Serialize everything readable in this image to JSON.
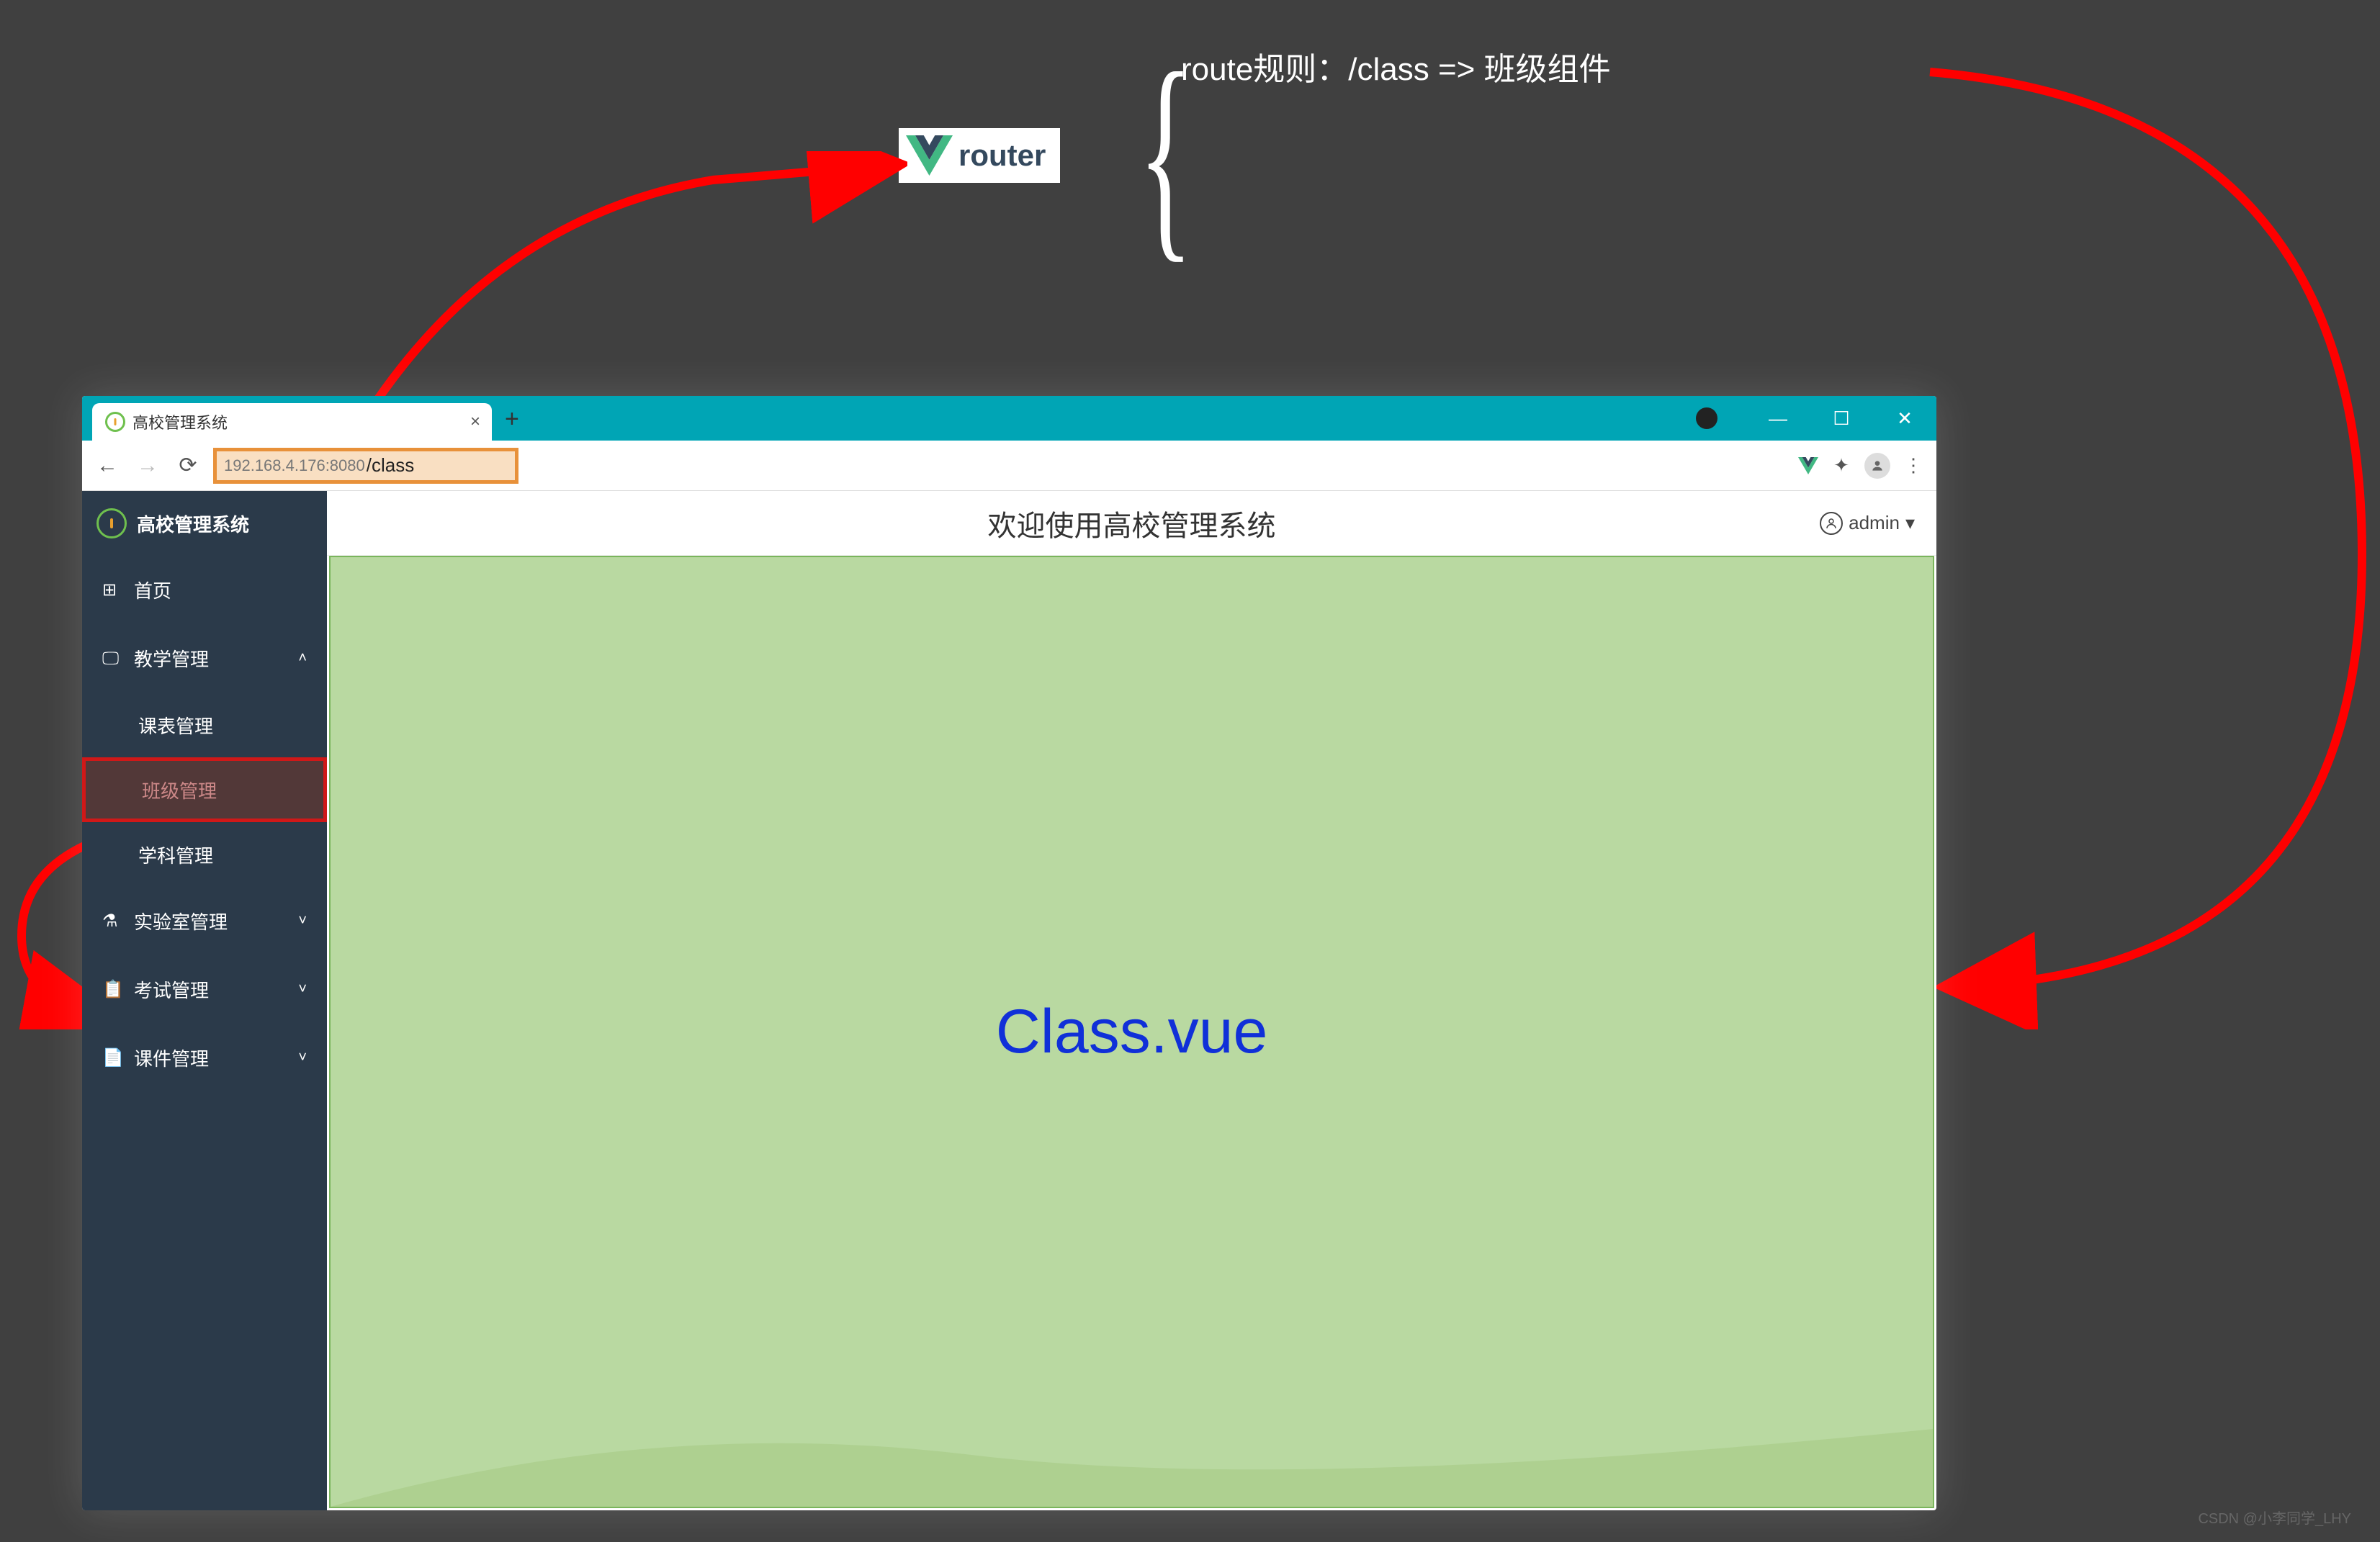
{
  "router": {
    "label": "router",
    "rule_text": "route规则：/class =>  班级组件"
  },
  "browser": {
    "tab_title": "高校管理系统",
    "url_ip": "192.168.4.176:8080",
    "url_path": "/class",
    "new_tab": "+",
    "close_tab": "×",
    "win_min": "—",
    "win_max": "☐",
    "win_close": "✕",
    "nav_back": "←",
    "nav_forward": "→",
    "nav_reload": "⟳",
    "ext_icon": "✦",
    "menu_icon": "⋮"
  },
  "app": {
    "sidebar_title": "高校管理系统",
    "menu": {
      "home": "首页",
      "teaching": "教学管理",
      "schedule": "课表管理",
      "class": "班级管理",
      "subject": "学科管理",
      "lab": "实验室管理",
      "exam": "考试管理",
      "courseware": "课件管理"
    },
    "welcome": "欢迎使用高校管理系统",
    "user": "admin",
    "user_chevron": "▾",
    "component": "Class.vue"
  },
  "watermark": "CSDN @小李同学_LHY"
}
